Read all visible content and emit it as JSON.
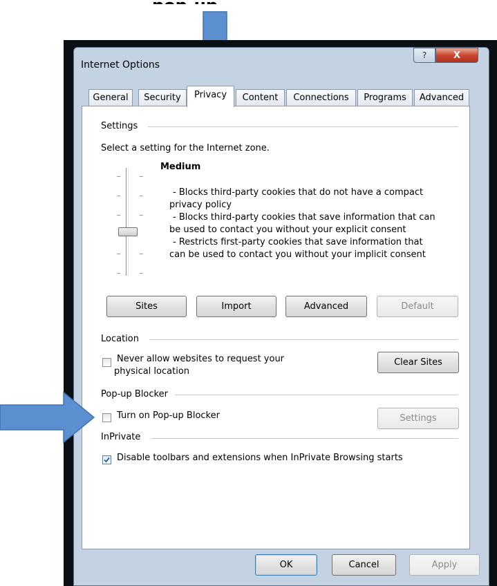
{
  "caption": "pop-up",
  "dialog": {
    "title": "Internet Options",
    "help_label": "?",
    "close_label": "X"
  },
  "tabs": [
    {
      "label": "General"
    },
    {
      "label": "Security"
    },
    {
      "label": "Privacy"
    },
    {
      "label": "Content"
    },
    {
      "label": "Connections"
    },
    {
      "label": "Programs"
    },
    {
      "label": "Advanced"
    }
  ],
  "settings": {
    "heading": "Settings",
    "description": "Select a setting for the Internet zone.",
    "level": "Medium",
    "lines": [
      "- Blocks third-party cookies that do not have a compact",
      "privacy policy",
      "- Blocks third-party cookies that save information that can",
      "be used to contact you without your explicit consent",
      "- Restricts first-party cookies that save information that",
      "can be used to contact you without your implicit consent"
    ],
    "buttons": {
      "sites": "Sites",
      "import": "Import",
      "advanced": "Advanced",
      "default": "Default"
    }
  },
  "location": {
    "heading": "Location",
    "checkbox_line1": "Never allow websites to request your",
    "checkbox_line2": "physical location",
    "checked": false,
    "clear_sites": "Clear Sites"
  },
  "popup": {
    "heading": "Pop-up Blocker",
    "checkbox_label": "Turn on Pop-up Blocker",
    "checked": false,
    "settings": "Settings"
  },
  "inprivate": {
    "heading": "InPrivate",
    "checkbox_label": "Disable toolbars and extensions when InPrivate Browsing starts",
    "checked": true
  },
  "footer": {
    "ok": "OK",
    "cancel": "Cancel",
    "apply": "Apply"
  },
  "colors": {
    "arrow": "#5b8fd0",
    "dialog_frame": "#c4d3e4"
  }
}
